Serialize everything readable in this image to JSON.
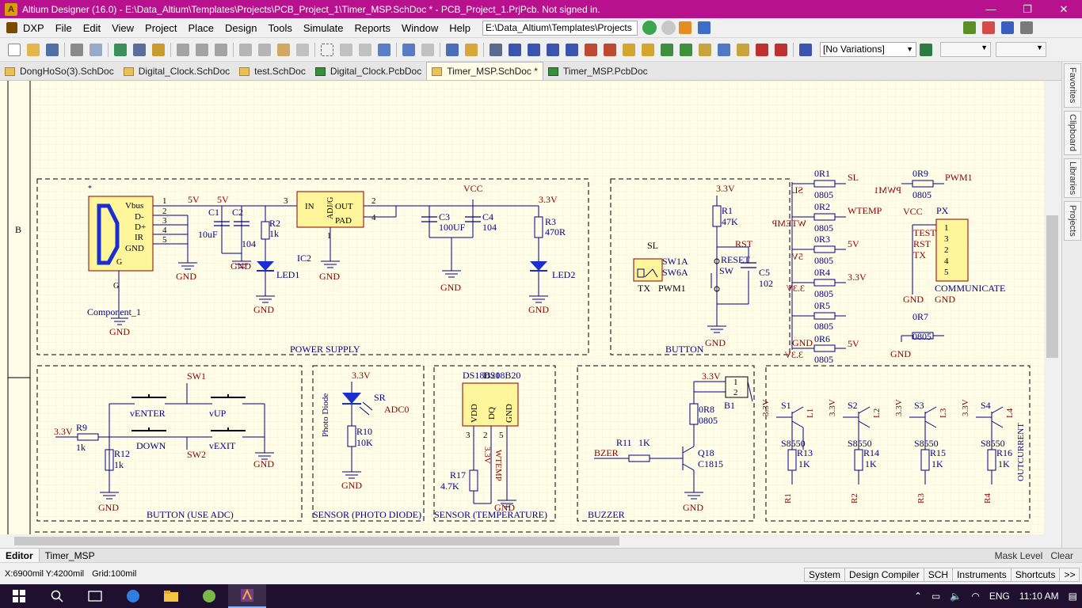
{
  "window": {
    "title": "Altium Designer (16.0) - E:\\Data_Altium\\Templates\\Projects\\PCB_Project_1\\Timer_MSP.SchDoc * - PCB_Project_1.PrjPcb. Not signed in.",
    "app_icon": "altium-logo-icon",
    "minimize_symbol": "—",
    "maximize_symbol": "❐",
    "close_symbol": "✕"
  },
  "menu": {
    "items": [
      "DXP",
      "File",
      "Edit",
      "View",
      "Project",
      "Place",
      "Design",
      "Tools",
      "Simulate",
      "Reports",
      "Window",
      "Help"
    ],
    "path": "E:\\Data_Altium\\Templates\\Projects"
  },
  "toolbar": {
    "variations": "[No Variations]"
  },
  "tabs": [
    {
      "label": "DongHoSo(3).SchDoc",
      "type": "sch",
      "active": false
    },
    {
      "label": "Digital_Clock.SchDoc",
      "type": "sch",
      "active": false
    },
    {
      "label": "test.SchDoc",
      "type": "sch",
      "active": false
    },
    {
      "label": "Digital_Clock.PcbDoc",
      "type": "pcb",
      "active": false
    },
    {
      "label": "Timer_MSP.SchDoc *",
      "type": "sch",
      "active": true
    },
    {
      "label": "Timer_MSP.PcbDoc",
      "type": "pcb",
      "active": false
    }
  ],
  "right_panels": [
    "Favorites",
    "Clipboard",
    "Libraries",
    "Projects"
  ],
  "schematic": {
    "zone_label": "B",
    "blocks": {
      "power_supply": "POWER SUPPLY",
      "button": "BUTTON",
      "button_adc": "BUTTON (USE ADC)",
      "sensor_photo": "SENSOR (PHOTO DIODE)",
      "sensor_temp": "SENSOR (TEMPERATURE)",
      "buzzer": "BUZZER"
    },
    "labels": {
      "vbus": "Vbus",
      "dm": "D-",
      "dp": "D+",
      "ir": "IR",
      "gnd": "GND",
      "g": "G",
      "star": "*",
      "component_1": "Component_1",
      "five_v": "5V",
      "three_v3": "3.3V",
      "vcc": "VCC",
      "c1": "C1",
      "c2": "C2",
      "c1_val": "10uF",
      "c2_val": "104",
      "r2": "R2",
      "r2_val": "1k",
      "led1": "LED1",
      "ic_in": "IN",
      "ic_out": "OUT",
      "ic_pad": "PAD",
      "ic_adj": "ADJ/G",
      "ic2": "IC2",
      "c3": "C3",
      "c3_val": "100UF",
      "c4": "C4",
      "c4_val": "104",
      "r3": "R3",
      "r3_val": "470R",
      "led2": "LED2",
      "pin1": "1",
      "pin2": "2",
      "pin3": "3",
      "pin4": "4",
      "pin5": "5",
      "r1": "R1",
      "r1_val": "47K",
      "rst": "RST",
      "reset": "RESET",
      "sw": "SW",
      "c5": "C5",
      "c5_val": "102",
      "sl": "SL",
      "sw1a": "SW1A",
      "sw6a": "SW6A",
      "tx": "TX",
      "pwm1": "PWM1",
      "r0_1": "0R1",
      "r0_2": "0R2",
      "r0_3": "0R3",
      "r0_4": "0R4",
      "r0_5": "0R5",
      "r0_6": "0R6",
      "r0_7": "0R7",
      "r0_9": "0R9",
      "pkg": "0805",
      "wtemp": "WTEMP",
      "px": "PX",
      "test": "TEST",
      "communicate": "COMMUNICATE",
      "sw1": "SW1",
      "sw2": "SW2",
      "r9": "R9",
      "r9_val": "1k",
      "r12": "R12",
      "r12_val": "1k",
      "venter": "vENTER",
      "vup": "vUP",
      "vdown": "DOWN",
      "vexit": "vEXIT",
      "sr": "SR",
      "adc0": "ADC0",
      "photo_diode": "Photo Diode",
      "r10": "R10",
      "r10_val": "10K",
      "ds18b20": "DS18B20",
      "vdd": "VDD",
      "dq": "DQ",
      "r17": "R17",
      "r17_val": "4.7K",
      "b1": "B1",
      "r8": "0R8",
      "r11": "R11",
      "r11_val": "1K",
      "bzer": "BZER",
      "q18": "Q18",
      "c1815": "C1815",
      "s1": "S1",
      "s2": "S2",
      "s3": "S3",
      "s4": "S4",
      "l1": "L1",
      "l2": "L2",
      "l3": "L3",
      "l4": "L4",
      "s8550": "S8550",
      "r13": "R13",
      "r14": "R14",
      "r15": "R15",
      "r16": "R16",
      "k1": "1K",
      "rr1": "R1",
      "rr2": "R2",
      "rr3": "R3",
      "rr4": "R4",
      "outcurrent": "OUTCURRENT"
    }
  },
  "editor_tabs": [
    "Editor",
    "Timer_MSP"
  ],
  "editor_right": {
    "mask": "Mask Level",
    "clear": "Clear"
  },
  "status": {
    "coords": "X:6900mil Y:4200mil",
    "grid": "Grid:100mil",
    "panels": [
      "System",
      "Design Compiler",
      "SCH",
      "Instruments",
      "Shortcuts"
    ],
    "more": ">>"
  },
  "taskbar": {
    "language": "ENG",
    "time": "11:10 AM"
  },
  "colors": {
    "title_bar": "#b7118e",
    "sheet_bg": "#fffde8",
    "wire": "#00008b",
    "component_fill": "#fff59a",
    "label_red": "#8b0000"
  }
}
